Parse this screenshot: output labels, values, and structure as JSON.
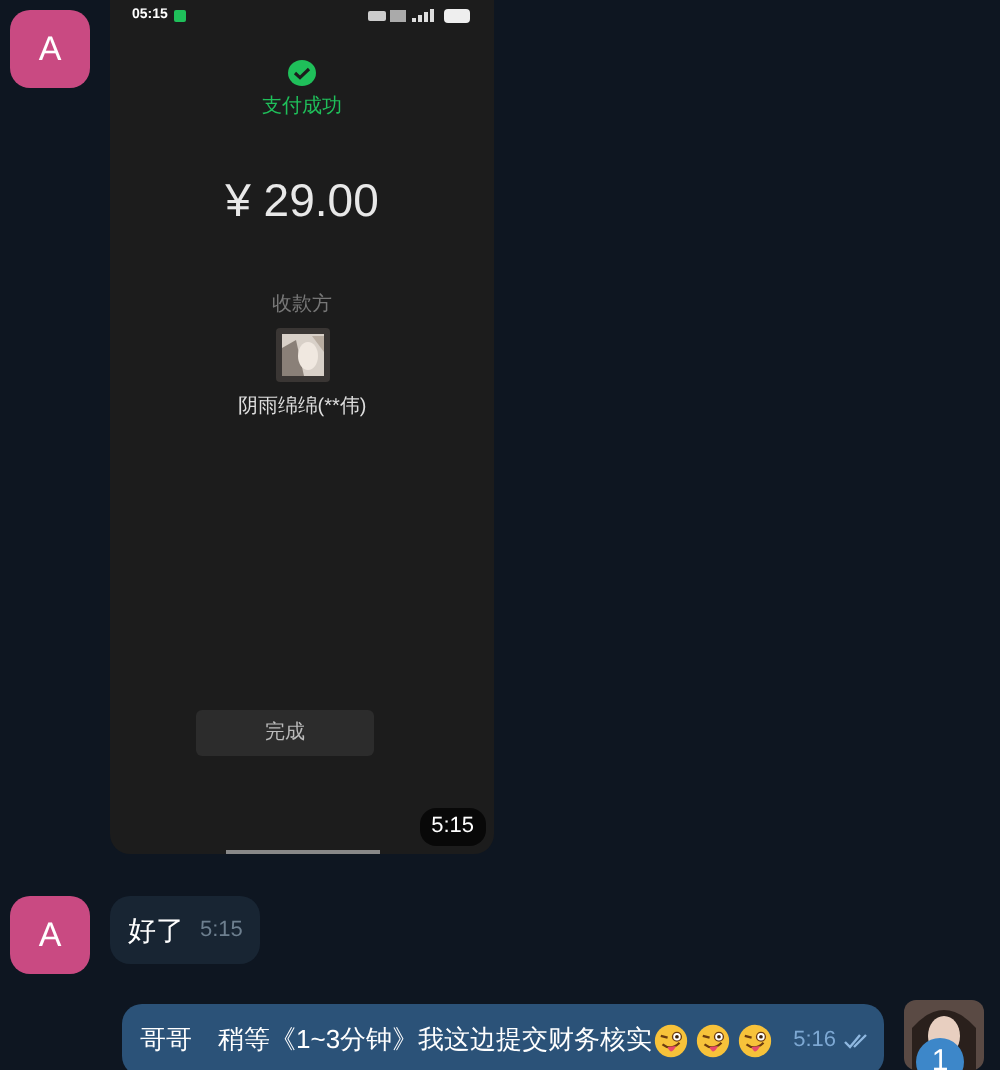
{
  "messages": [
    {
      "sender": "A",
      "time": "5:15",
      "screenshot": {
        "status_time": "05:15",
        "status": "支付成功",
        "amount": "¥ 29.00",
        "payee_label": "收款方",
        "payee_name": "阴雨绵绵(**伟)",
        "done_button": "完成"
      }
    },
    {
      "kind": "text",
      "sender": "A",
      "text": "好了",
      "time": "5:15"
    },
    {
      "kind": "outgoing",
      "text": "哥哥　稍等《1~3分钟》我这边提交财务核实",
      "emoji": [
        {
          "kind": "tongue-wink"
        },
        {
          "kind": "tongue-wink"
        },
        {
          "kind": "tongue-wink"
        }
      ],
      "time": "5:16",
      "read": true,
      "badge": "1"
    }
  ]
}
